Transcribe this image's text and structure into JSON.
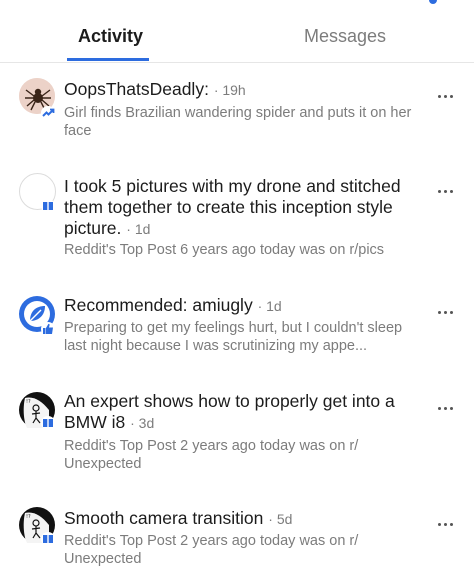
{
  "tabs": {
    "activity": "Activity",
    "messages": "Messages"
  },
  "items": [
    {
      "title": "OopsThatsDeadly:",
      "age": "· 19h",
      "subtitle": "Girl finds Brazilian wandering spider and puts it on her face",
      "avatar_icon": "spider-avatar",
      "badge_icon": "trending-icon"
    },
    {
      "title": "I took 5 pictures with my drone and stitched them together to create this inception style picture.",
      "age": "· 1d",
      "subtitle": "Reddit's Top Post 6 years ago today was on r/pics",
      "avatar_icon": "blank-avatar",
      "badge_icon": "book-icon"
    },
    {
      "title": "Recommended: amiugly",
      "age": "· 1d",
      "subtitle": "Preparing to get my feelings hurt, but I couldn't sleep last night because I was scrutinizing my appe...",
      "avatar_icon": "leaf-avatar",
      "badge_icon": "thumbs-up-icon"
    },
    {
      "title": "An expert shows how to properly get into a BMW i8",
      "age": "· 3d",
      "subtitle": "Reddit's Top Post 2 years ago today was on r/ Unexpected",
      "avatar_icon": "stickman-avatar",
      "badge_icon": "book-icon"
    },
    {
      "title": "Smooth camera transition",
      "age": "· 5d",
      "subtitle": "Reddit's Top Post 2 years ago today was on r/ Unexpected",
      "avatar_icon": "stickman-avatar",
      "badge_icon": "book-icon"
    }
  ],
  "colors": {
    "accent": "#2d6cdf",
    "text": "#1c1c1c",
    "muted": "#7c7c7c"
  }
}
